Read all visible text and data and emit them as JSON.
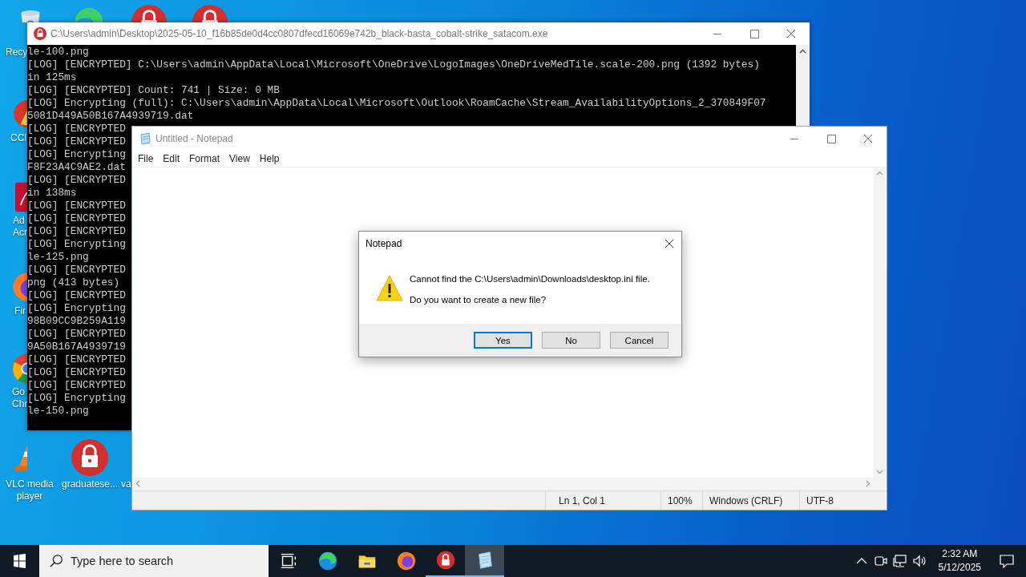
{
  "desktop_icons": [
    {
      "kind": "recycle",
      "label": [
        "Recy"
      ]
    },
    {
      "kind": "edge"
    },
    {
      "kind": "lock"
    },
    {
      "kind": "lock"
    },
    {
      "kind": "ccleaner",
      "label": [
        "CCl"
      ]
    },
    {
      "kind": "acrobat",
      "label": [
        "Ad",
        "Acr"
      ]
    },
    {
      "kind": "firefox",
      "label": [
        "Fir"
      ]
    },
    {
      "kind": "chrome",
      "label": [
        "Go",
        "Chr"
      ]
    },
    {
      "kind": "vlc",
      "label": [
        "VLC media",
        "player"
      ]
    },
    {
      "kind": "lock",
      "label": [
        "graduatese..."
      ]
    },
    {
      "kind": "covered",
      "label": [
        "va"
      ]
    }
  ],
  "console": {
    "title": "C:\\Users\\admin\\Desktop\\2025-05-10_f16b85de0d4cc0807dfecd16069e742b_black-basta_cobalt-strike_satacom.exe",
    "lines": [
      "le-100.png",
      "[LOG] [ENCRYPTED] C:\\Users\\admin\\AppData\\Local\\Microsoft\\OneDrive\\LogoImages\\OneDriveMedTile.scale-200.png (1392 bytes)",
      "in 125ms",
      "[LOG] [ENCRYPTED] Count: 741 | Size: 0 MB",
      "[LOG] Encrypting (full): C:\\Users\\admin\\AppData\\Local\\Microsoft\\Outlook\\RoamCache\\Stream_AvailabilityOptions_2_370849F07",
      "5081D449A50B167A4939719.dat",
      "[LOG] [ENCRYPTED",
      "[LOG] [ENCRYPTED",
      "[LOG] Encrypting",
      "F8F23A4C9AE2.dat",
      "[LOG] [ENCRYPTED",
      "in 138ms",
      "[LOG] [ENCRYPTED",
      "[LOG] [ENCRYPTED",
      "[LOG] [ENCRYPTED",
      "[LOG] Encrypting",
      "le-125.png",
      "[LOG] [ENCRYPTED",
      "png (413 bytes)",
      "[LOG] [ENCRYPTED",
      "[LOG] Encrypting",
      "98B09CC9B259A119",
      "[LOG] [ENCRYPTED",
      "9A50B167A4939719",
      "[LOG] [ENCRYPTED",
      "[LOG] [ENCRYPTED",
      "[LOG] [ENCRYPTED",
      "[LOG] Encrypting",
      "le-150.png"
    ]
  },
  "notepad": {
    "title": "Untitled - Notepad",
    "menu": [
      "File",
      "Edit",
      "Format",
      "View",
      "Help"
    ],
    "status": [
      "Ln 1, Col 1",
      "100%",
      "Windows (CRLF)",
      "UTF-8"
    ]
  },
  "dialog": {
    "title": "Notepad",
    "message": "Cannot find the C:\\Users\\admin\\Downloads\\desktop.ini file.",
    "question": "Do you want to create a new file?",
    "buttons": [
      {
        "label": "Yes",
        "selected": true
      },
      {
        "label": "No",
        "selected": false
      },
      {
        "label": "Cancel",
        "selected": false
      }
    ]
  },
  "taskbar": {
    "search_placeholder": "Type here to search",
    "apps": [
      {
        "kind": "taskview",
        "running": false,
        "active": false
      },
      {
        "kind": "edge",
        "running": false,
        "active": false
      },
      {
        "kind": "explorer",
        "running": false,
        "active": false
      },
      {
        "kind": "firefox",
        "running": false,
        "active": false
      },
      {
        "kind": "lock",
        "running": true,
        "active": false
      },
      {
        "kind": "notepad",
        "running": true,
        "active": true
      }
    ],
    "time": "2:32 AM",
    "date": "5/12/2025"
  }
}
